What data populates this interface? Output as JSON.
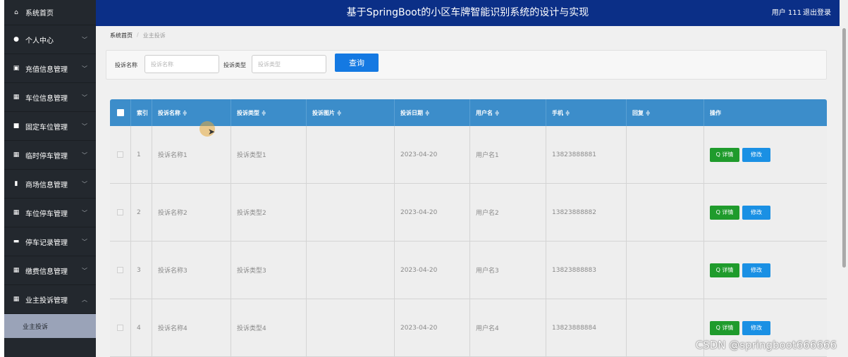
{
  "topbar": {
    "title": "基于SpringBoot的小区车牌智能识别系统的设计与实现",
    "user": "用户 111",
    "logout": "退出登录"
  },
  "sidebar": {
    "items": [
      {
        "label": "系统首页",
        "icon": "home-icon",
        "glyph": "⌂"
      },
      {
        "label": "个人中心",
        "icon": "user-icon",
        "glyph": "●"
      },
      {
        "label": "充值信息管理",
        "icon": "wallet-icon",
        "glyph": "▣"
      },
      {
        "label": "车位信息管理",
        "icon": "grid-icon",
        "glyph": "▦"
      },
      {
        "label": "固定车位管理",
        "icon": "bookmark-icon",
        "glyph": "■"
      },
      {
        "label": "临时停车管理",
        "icon": "grid-icon",
        "glyph": "▦"
      },
      {
        "label": "商场信息管理",
        "icon": "bar-chart-icon",
        "glyph": "▮"
      },
      {
        "label": "车位停车管理",
        "icon": "grid-icon",
        "glyph": "▦"
      },
      {
        "label": "停车记录管理",
        "icon": "card-icon",
        "glyph": "▬"
      },
      {
        "label": "缴费信息管理",
        "icon": "grid-icon",
        "glyph": "▦"
      },
      {
        "label": "业主投诉管理",
        "icon": "grid-icon",
        "glyph": "▦"
      }
    ],
    "subitem": "业主投诉"
  },
  "breadcrumb": {
    "home": "系统首页",
    "separator": "/",
    "current": "业主投诉"
  },
  "search": {
    "name_label": "投诉名称",
    "name_placeholder": "投诉名称",
    "type_label": "投诉类型",
    "type_placeholder": "投诉类型",
    "button": "查询"
  },
  "table": {
    "headers": [
      "索引",
      "投诉名称 ≑",
      "投诉类型 ≑",
      "投诉图片 ≑",
      "投诉日期 ≑",
      "用户名 ≑",
      "手机 ≑",
      "回复 ≑",
      "操作"
    ],
    "rows": [
      {
        "index": "1",
        "name": "投诉名称1",
        "type": "投诉类型1",
        "date": "2023-04-20",
        "user": "用户名1",
        "phone": "13823888881"
      },
      {
        "index": "2",
        "name": "投诉名称2",
        "type": "投诉类型2",
        "date": "2023-04-20",
        "user": "用户名2",
        "phone": "13823888882"
      },
      {
        "index": "3",
        "name": "投诉名称3",
        "type": "投诉类型3",
        "date": "2023-04-20",
        "user": "用户名3",
        "phone": "13823888883"
      },
      {
        "index": "4",
        "name": "投诉名称4",
        "type": "投诉类型4",
        "date": "2023-04-20",
        "user": "用户名4",
        "phone": "13823888884"
      }
    ],
    "detail_label": "Q 详情",
    "edit_label": "修改"
  },
  "watermark": "CSDN @springboot666666",
  "colors": {
    "topbar": "#0b2f87",
    "sidebar": "#23282e",
    "header": "#3c8dca",
    "detail": "#1f9b2c",
    "edit": "#1a90e4"
  }
}
